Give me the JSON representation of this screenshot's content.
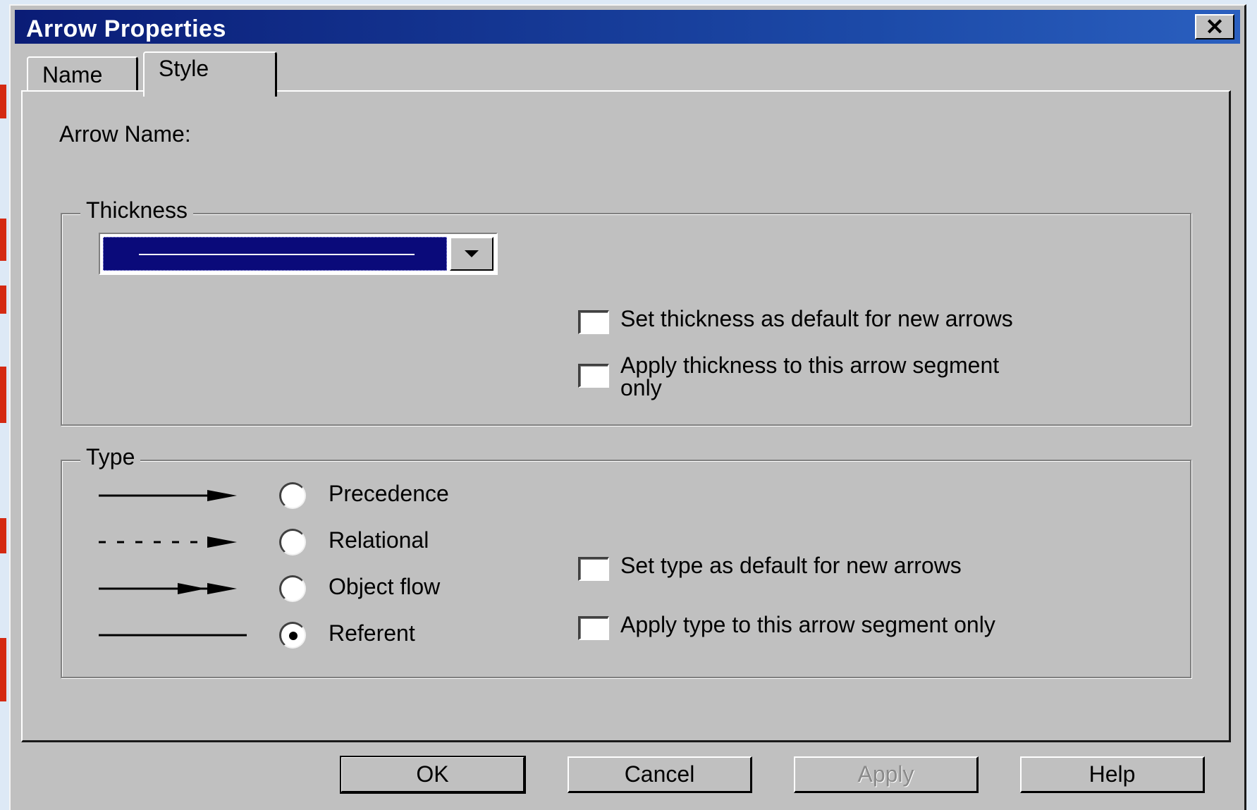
{
  "window": {
    "title": "Arrow Properties",
    "close_glyph": "✕"
  },
  "tabs": [
    {
      "label": "Name"
    },
    {
      "label": "Style",
      "active": true
    }
  ],
  "style": {
    "arrow_name_label": "Arrow Name:",
    "thickness": {
      "group_label": "Thickness",
      "checkboxes": [
        {
          "label": "Set thickness as default for new arrows",
          "checked": false
        },
        {
          "label": "Apply thickness to this arrow segment",
          "label_cont": "only",
          "checked": false
        }
      ]
    },
    "type": {
      "group_label": "Type",
      "options": [
        {
          "label": "Precedence",
          "icon": "solid-arrow-icon",
          "selected": false
        },
        {
          "label": "Relational",
          "icon": "dashed-arrow-icon",
          "selected": false
        },
        {
          "label": "Object flow",
          "icon": "double-arrow-icon",
          "selected": false
        },
        {
          "label": "Referent",
          "icon": "plain-line-icon",
          "selected": true
        }
      ],
      "checkboxes": [
        {
          "label": "Set type as default for new arrows",
          "checked": false
        },
        {
          "label": "Apply type to this arrow segment only",
          "checked": false
        }
      ]
    }
  },
  "buttons": {
    "ok": "OK",
    "cancel": "Cancel",
    "apply": "Apply",
    "help": "Help"
  }
}
